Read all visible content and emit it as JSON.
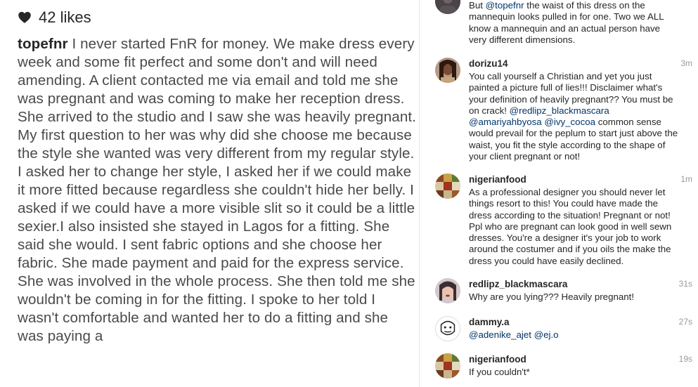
{
  "post": {
    "likes": "42 likes",
    "caption_user": "topefnr",
    "caption_text": " I never started FnR for money. We make dress every week and some fit perfect and some don't and will need amending. A client contacted me via email and told me she was pregnant and was coming to make her reception dress. She arrived to the studio and I saw she was heavily pregnant. My first question to her was why did she choose me because the style she wanted was very different from my regular style. I asked her to change her style, I asked her if we could make it more fitted because regardless she couldn't hide her belly. I asked if we could have a more visible slit so it could be a little sexier.I also insisted she stayed in Lagos for a fitting. She said she would. I sent fabric options and she choose her fabric. She made payment and paid for the express service. She was involved in the whole process. She then told me she wouldn't be coming in for the fitting. I spoke to her told I wasn't comfortable and wanted her to do a fitting and she was paying a"
  },
  "comments": [
    {
      "username": "",
      "time": "",
      "segments": [
        {
          "text": "But ",
          "mention": false
        },
        {
          "text": "@topefnr",
          "mention": true
        },
        {
          "text": " the waist of this dress on the mannequin looks pulled in for one. Two we ALL know a mannequin and an actual person have very different dimensions.",
          "mention": false
        }
      ]
    },
    {
      "username": "dorizu14",
      "time": "3m",
      "segments": [
        {
          "text": "You call yourself a Christian and yet you just painted a picture full of lies!!! Disclaimer what's your definition of heavily pregnant?? You must be on crack! ",
          "mention": false
        },
        {
          "text": "@redlipz_blackmascara",
          "mention": true
        },
        {
          "text": " ",
          "mention": false
        },
        {
          "text": "@amariyahbyosa",
          "mention": true
        },
        {
          "text": " ",
          "mention": false
        },
        {
          "text": "@ivy_cocoa",
          "mention": true
        },
        {
          "text": " common sense would prevail for the peplum to start just above the waist, you fit the style according to the shape of your client pregnant or not!",
          "mention": false
        }
      ]
    },
    {
      "username": "nigerianfood",
      "time": "1m",
      "segments": [
        {
          "text": "As a professional designer you should never let things resort to this! You could have made the dress according to the situation! Pregnant or not! Ppl who are pregnant can look good in well sewn dresses. You're a designer it's your job to work around the costumer and if you oils the make the dress you could have easily declined.",
          "mention": false
        }
      ]
    },
    {
      "username": "redlipz_blackmascara",
      "time": "31s",
      "segments": [
        {
          "text": "Why are you lying??? Heavily pregnant!",
          "mention": false
        }
      ]
    },
    {
      "username": "dammy.a",
      "time": "27s",
      "segments": [
        {
          "text": "@adenike_ajet",
          "mention": true
        },
        {
          "text": " ",
          "mention": false
        },
        {
          "text": "@ej.o",
          "mention": true
        }
      ]
    },
    {
      "username": "nigerianfood",
      "time": "19s",
      "segments": [
        {
          "text": "If you couldn't*",
          "mention": false
        }
      ]
    }
  ],
  "colors": {
    "text": "#262626",
    "caption_text": "#4a4a4a",
    "mention": "#003569",
    "timestamp": "#999999"
  },
  "icons": {
    "likes": "heart-icon"
  }
}
